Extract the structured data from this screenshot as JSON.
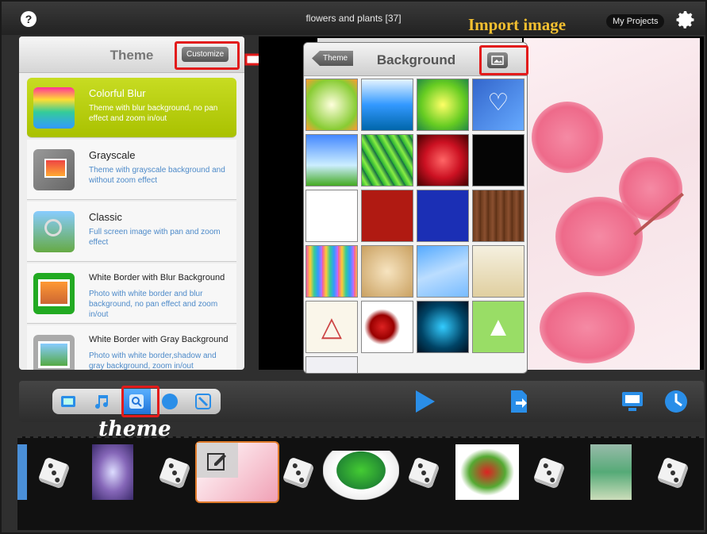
{
  "window": {
    "title": "flowers and plants [37]"
  },
  "annotations": {
    "import_image": "Import image",
    "theme": "theme"
  },
  "header": {
    "my_projects": "My Projects"
  },
  "theme_panel": {
    "title": "Theme",
    "customize": "Customize",
    "items": [
      {
        "name": "Colorful Blur",
        "desc": "Theme with blur background, no pan effect and zoom in/out",
        "selected": true
      },
      {
        "name": "Grayscale",
        "desc": "Theme with grayscale background and without zoom effect"
      },
      {
        "name": "Classic",
        "desc": "Full screen image with pan and zoom effect"
      },
      {
        "name": "White Border with Blur Background",
        "desc": "Photo with white border and blur background, no pan effect and zoom in/out"
      },
      {
        "name": "White Border with Gray Background",
        "desc": "Photo with white border,shadow and gray background, zoom in/out"
      }
    ]
  },
  "background_panel": {
    "title": "Background",
    "back": "Theme"
  },
  "colors": {
    "accent": "#b5c90c",
    "highlight": "#e21b1b",
    "annotation": "#f4c030",
    "icon_blue": "#2a8ee8"
  },
  "toolbar": {
    "icons": [
      "photo-icon",
      "music-icon",
      "theme-icon",
      "globe-icon",
      "edit-icon"
    ],
    "right_icons": [
      "play-icon",
      "export-icon",
      "display-icon",
      "clock-icon"
    ]
  }
}
